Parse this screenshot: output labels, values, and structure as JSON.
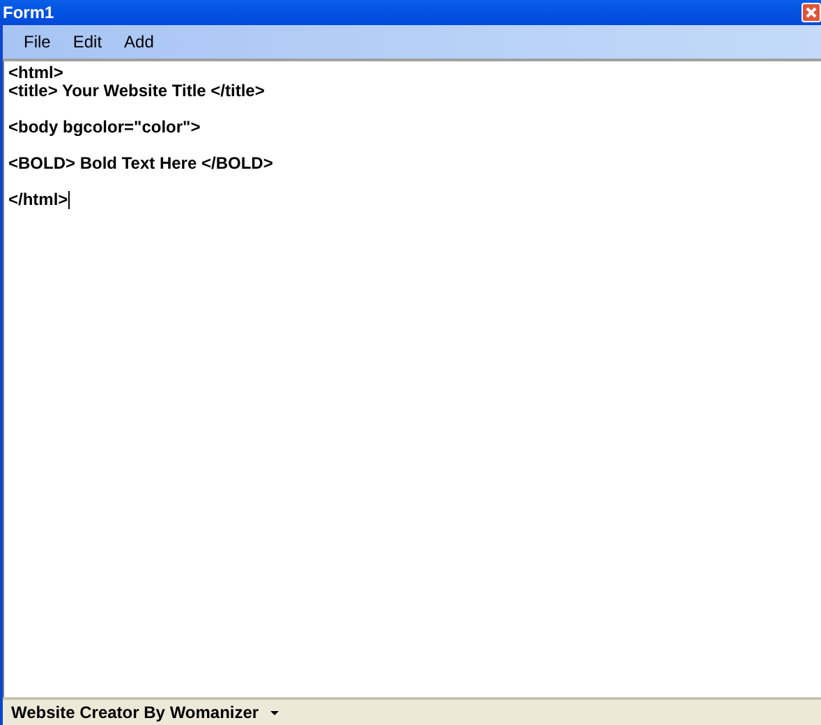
{
  "window": {
    "title": "Form1"
  },
  "menu": [
    {
      "label": "File"
    },
    {
      "label": "Edit"
    },
    {
      "label": "Add"
    }
  ],
  "editor": {
    "value": "<html>\n<title> Your Website Title </title>\n\n<body bgcolor=\"color\">\n\n<BOLD> Bold Text Here </BOLD>\n\n</html>"
  },
  "status_bar": {
    "label": "Website Creator By Womanizer"
  }
}
